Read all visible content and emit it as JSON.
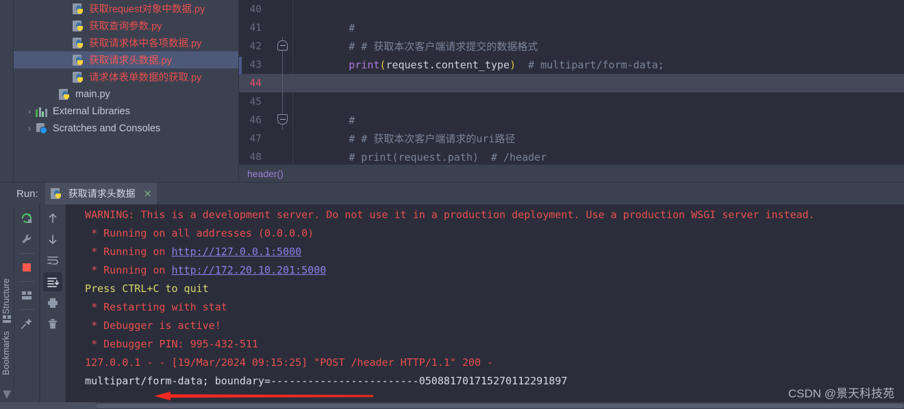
{
  "project_tree": {
    "items": [
      {
        "label": "获取request对象中数据.py",
        "icon": "python-file-icon",
        "style": "py-red",
        "indent": 3,
        "selected": false
      },
      {
        "label": "获取查询参数.py",
        "icon": "python-file-icon",
        "style": "py-red",
        "indent": 3,
        "selected": false
      },
      {
        "label": "获取请求体中各项数据.py",
        "icon": "python-file-icon",
        "style": "py-red",
        "indent": 3,
        "selected": false
      },
      {
        "label": "获取请求头数据.py",
        "icon": "python-file-icon",
        "style": "py-red",
        "indent": 3,
        "selected": true
      },
      {
        "label": "请求体表单数据的获取.py",
        "icon": "python-file-icon",
        "style": "py-red",
        "indent": 3,
        "selected": false
      },
      {
        "label": "main.py",
        "icon": "python-file-icon",
        "style": "plain",
        "indent": 2,
        "selected": false
      },
      {
        "label": "External Libraries",
        "icon": "library-icon",
        "style": "plain",
        "indent": 1,
        "chevron": "›",
        "selected": false
      },
      {
        "label": "Scratches and Consoles",
        "icon": "scratches-icon",
        "style": "plain",
        "indent": 1,
        "chevron": "›",
        "selected": false
      }
    ]
  },
  "editor": {
    "breadcrumb": "header()",
    "lines": [
      {
        "num": "40",
        "segments": [],
        "fold": "",
        "current": false
      },
      {
        "num": "41",
        "segments": [
          {
            "t": "        #",
            "c": "tk-cmt"
          }
        ],
        "fold": "",
        "current": false
      },
      {
        "num": "42",
        "segments": [
          {
            "t": "        # # 获取本次客户端请求提交的数据格式",
            "c": "tk-cmt"
          }
        ],
        "fold": "top",
        "current": false
      },
      {
        "num": "43",
        "segments": [
          {
            "t": "        ",
            "c": "tk-id"
          },
          {
            "t": "print",
            "c": "tk-fn"
          },
          {
            "t": "(",
            "c": "tk-par"
          },
          {
            "t": "request.content_type",
            "c": "tk-id"
          },
          {
            "t": ")",
            "c": "tk-par"
          },
          {
            "t": "  # multipart/form-data;",
            "c": "tk-cmt"
          }
        ],
        "fold": "",
        "current": false
      },
      {
        "num": "44",
        "segments": [],
        "fold": "",
        "current": true
      },
      {
        "num": "45",
        "segments": [],
        "fold": "",
        "current": false
      },
      {
        "num": "46",
        "segments": [
          {
            "t": "        #",
            "c": "tk-cmt"
          }
        ],
        "fold": "bot",
        "current": false
      },
      {
        "num": "47",
        "segments": [
          {
            "t": "        # # 获取本次客户端请求的uri路径",
            "c": "tk-cmt"
          }
        ],
        "fold": "",
        "current": false
      },
      {
        "num": "48",
        "segments": [
          {
            "t": "        # print(request.path)  # /header",
            "c": "tk-cmt"
          }
        ],
        "fold": "",
        "current": false
      }
    ]
  },
  "run_panel": {
    "run_label": "Run:",
    "tab_title": "获取请求头数据",
    "tab_close": "✕",
    "side_labels": {
      "structure": "Structure",
      "bookmarks": "Bookmarks"
    },
    "toolbar_left": [
      {
        "name": "rerun-icon",
        "title": "Rerun"
      },
      {
        "name": "settings-wrench-icon",
        "title": "Modify Run Configuration"
      },
      {
        "name": "stop-icon",
        "title": "Stop"
      },
      {
        "name": "layout-icon",
        "title": "Layout"
      },
      {
        "name": "pin-icon",
        "title": "Pin Tab"
      }
    ],
    "toolbar_right": [
      {
        "name": "arrow-up-icon",
        "title": "Up"
      },
      {
        "name": "arrow-down-icon",
        "title": "Down"
      },
      {
        "name": "soft-wrap-icon",
        "title": "Soft-Wrap"
      },
      {
        "name": "scroll-to-end-icon",
        "title": "Scroll to End",
        "active": true
      },
      {
        "name": "print-icon",
        "title": "Print"
      },
      {
        "name": "trash-icon",
        "title": "Clear All"
      }
    ],
    "console_lines": [
      {
        "text": "  WARNING: This is a development server. Do not use it in a production deployment. Use a production WSGI server instead.",
        "color": "red"
      },
      {
        "text": "   * Running on all addresses (0.0.0.0)",
        "color": "red"
      },
      {
        "pre": "   * Running on ",
        "link": "http://127.0.0.1:5000",
        "color": "red"
      },
      {
        "pre": "   * Running on ",
        "link": "http://172.20.10.201:5000",
        "color": "red"
      },
      {
        "text": "  Press CTRL+C to quit",
        "color": "yellow"
      },
      {
        "text": "   * Restarting with stat",
        "color": "red"
      },
      {
        "text": "   * Debugger is active!",
        "color": "red"
      },
      {
        "text": "   * Debugger PIN: 995-432-511",
        "color": "red"
      },
      {
        "text": "  127.0.0.1 - - [19/Mar/2024 09:15:25] \"POST /header HTTP/1.1\" 200 -",
        "color": "red"
      },
      {
        "text": "  multipart/form-data; boundary=------------------------050881701715270112291897",
        "color": "white"
      }
    ]
  },
  "annotation": {
    "arrow": "red-left-arrow"
  },
  "watermark": {
    "text": "CSDN @景天科技苑"
  },
  "colors": {
    "editor_bg": "#2b2d3a",
    "panel_bg": "#3c4150",
    "selection": "#4e5878",
    "current_line": "#434758",
    "console_red": "#e8504e",
    "console_yellow": "#d8d86a",
    "link_purple": "#8f7fe8",
    "accent_arrow": "#f02a22"
  }
}
